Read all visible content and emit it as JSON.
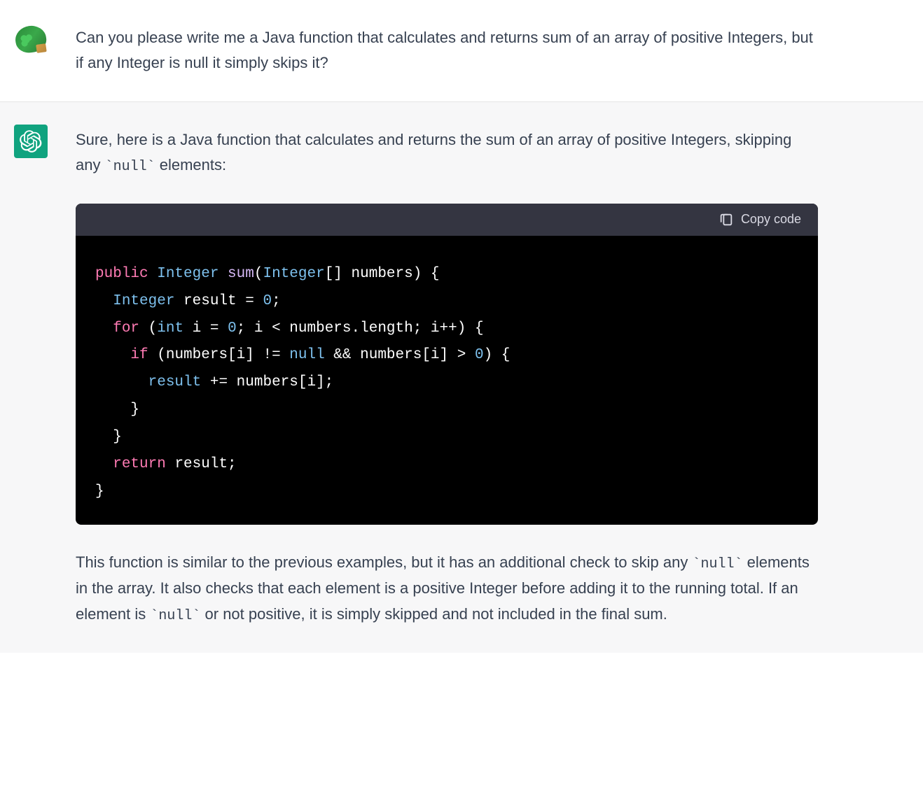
{
  "user": {
    "text": "Can you please write me a Java function that calculates and returns sum of an array of positive Integers, but if any Integer is null it simply skips it?"
  },
  "assistant": {
    "intro_part1": "Sure, here is a Java function that calculates and returns the sum of an array of positive Integers, skipping any ",
    "intro_code": "`null`",
    "intro_part2": " elements:",
    "copy_label": "Copy code",
    "code": {
      "l1_public": "public",
      "l1_type1": " Integer",
      "l1_func": " sum",
      "l1_paren_open": "(",
      "l1_type2": "Integer",
      "l1_rest": "[] numbers) {",
      "l2_indent": "  ",
      "l2_type": "Integer",
      "l2_rest": " result = ",
      "l2_num": "0",
      "l2_semi": ";",
      "l3_indent": "  ",
      "l3_for": "for",
      "l3_space_paren": " (",
      "l3_int": "int",
      "l3_rest1": " i = ",
      "l3_num": "0",
      "l3_rest2": "; i < numbers.length; i++) {",
      "l4_indent": "    ",
      "l4_if": "if",
      "l4_rest1": " (numbers[i] != ",
      "l4_null": "null",
      "l4_rest2": " && numbers[i] > ",
      "l4_num": "0",
      "l4_rest3": ") {",
      "l5_indent": "      ",
      "l5_result": "result",
      "l5_rest": " += numbers[i];",
      "l6": "    }",
      "l7": "  }",
      "l8_indent": "  ",
      "l8_return": "return",
      "l8_rest": " result;",
      "l9": "}"
    },
    "outro_p1": "This function is similar to the previous examples, but it has an additional check to skip any ",
    "outro_c1": "`null`",
    "outro_p2": " elements in the array. It also checks that each element is a positive Integer before adding it to the running total. If an element is ",
    "outro_c2": "`null`",
    "outro_p3": " or not positive, it is simply skipped and not included in the final sum."
  }
}
